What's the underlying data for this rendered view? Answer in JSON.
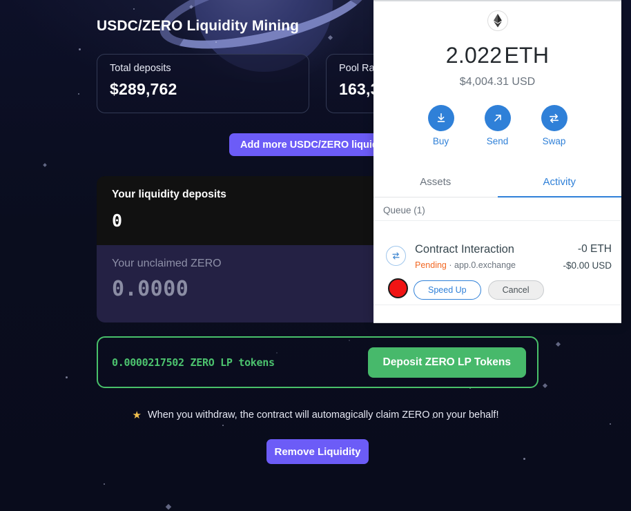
{
  "page": {
    "title": "USDC/ZERO Liquidity Mining",
    "stats": [
      {
        "label": "Total deposits",
        "value": "$289,762"
      },
      {
        "label": "Pool Rate",
        "value": "163,3"
      }
    ],
    "add_liquidity_label": "Add more USDC/ZERO liquidity",
    "deposits": {
      "label": "Your liquidity deposits",
      "value": "0"
    },
    "unclaimed": {
      "label": "Your unclaimed ZERO",
      "value": "0.0000"
    },
    "lp": {
      "amount": "0.0000217502 ZERO LP tokens",
      "deposit_label": "Deposit ZERO LP Tokens"
    },
    "hint": {
      "icon": "star-icon",
      "text": "When you withdraw, the contract will automagically claim ZERO on your behalf!"
    },
    "remove_liquidity_label": "Remove Liquidity",
    "colors": {
      "accent_purple": "#6c5cf7",
      "accent_green": "#47b96b",
      "lp_border_green": "#49c16a",
      "background": "#0b0e20",
      "deposits_card": "#111111",
      "unclaimed_card": "#242144"
    }
  },
  "wallet": {
    "token_icon": "ethereum-icon",
    "balance_amount": "2.022",
    "balance_unit": "ETH",
    "fiat_balance": "$4,004.31 USD",
    "actions": [
      {
        "label": "Buy",
        "icon": "download-arrow-icon"
      },
      {
        "label": "Send",
        "icon": "diagonal-arrow-icon"
      },
      {
        "label": "Swap",
        "icon": "swap-arrows-icon"
      }
    ],
    "tabs": [
      {
        "label": "Assets",
        "active": false
      },
      {
        "label": "Activity",
        "active": true
      }
    ],
    "queue_header": "Queue (1)",
    "transaction": {
      "icon": "swap-arrows-icon",
      "title": "Contract Interaction",
      "status": "Pending",
      "separator": "·",
      "origin": "app.0.exchange",
      "amount": "-0 ETH",
      "fiat": "-$0.00 USD",
      "speed_up_label": "Speed Up",
      "cancel_label": "Cancel"
    },
    "colors": {
      "accent_blue": "#2f80d8",
      "pending_orange": "#f26722"
    }
  },
  "cursor": {
    "marker": "click-marker",
    "color": "#f01414"
  }
}
